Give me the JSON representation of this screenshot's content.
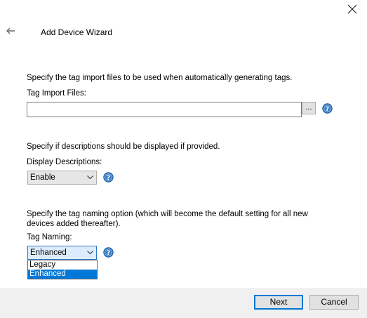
{
  "window": {
    "title": "Add Device Wizard"
  },
  "tag_import": {
    "description": "Specify the tag import files to be used when automatically generating tags.",
    "label": "Tag Import Files:",
    "value": "",
    "browse_label": "..."
  },
  "descriptions": {
    "description": "Specify if descriptions should be displayed if provided.",
    "label": "Display Descriptions:",
    "value": "Enable"
  },
  "tag_naming": {
    "description": "Specify the tag naming option (which will become the default setting for all new devices added thereafter).",
    "label": "Tag Naming:",
    "value": "Enhanced",
    "options": [
      "Legacy",
      "Enhanced"
    ],
    "selected_option": "Enhanced"
  },
  "footer": {
    "next_label": "Next",
    "cancel_label": "Cancel"
  },
  "colors": {
    "accent": "#0078d7",
    "help_icon": "#3c7fc4",
    "footer_bg": "#f0f0f0"
  },
  "icons": {
    "close": "close-icon",
    "back": "back-arrow-icon",
    "help": "help-icon",
    "dropdown": "chevron-down-icon"
  }
}
